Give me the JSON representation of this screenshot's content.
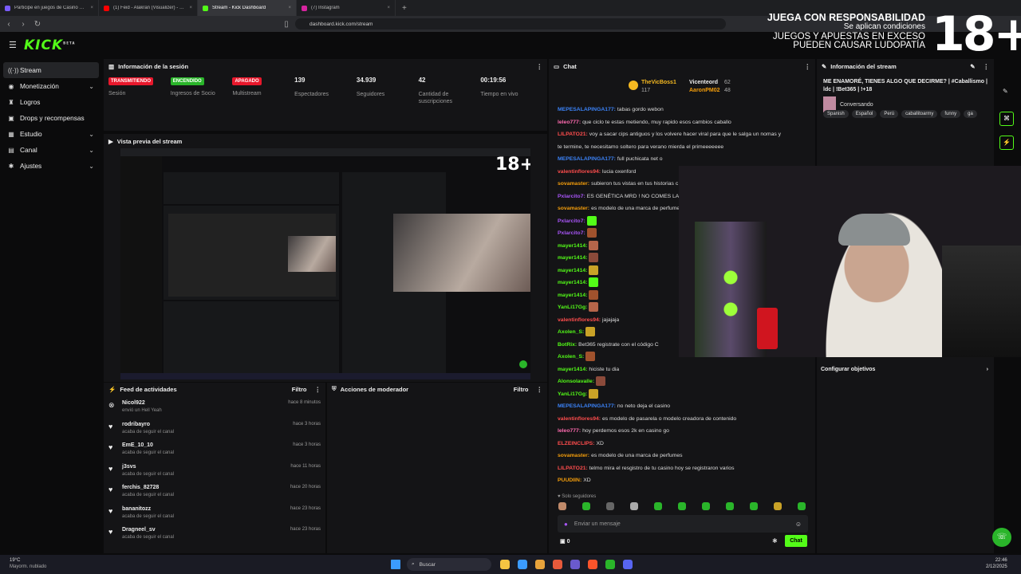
{
  "browser": {
    "tabs": [
      {
        "title": "Participe en juegos de Casino en líne",
        "color": "#7a5cff",
        "active": false
      },
      {
        "title": "(1) Feid - Alakran (Visualizer) - YouTu",
        "color": "#ff0000",
        "active": false
      },
      {
        "title": "Stream - Kick Dashboard",
        "color": "#53fc18",
        "active": true
      },
      {
        "title": "(7) Instagram",
        "color": "#d6249f",
        "active": false
      }
    ],
    "url": "dashboard.kick.com/stream"
  },
  "overlay": {
    "line1": "JUEGA CON RESPONSABILIDAD",
    "line2": "Se aplican condiciones",
    "line3": "JUEGOS Y APUESTAS EN EXCESO",
    "line4": "PUEDEN CAUSAR LUDOPATÍA",
    "age": "18+"
  },
  "sidebar": {
    "logo": "KICK",
    "logo_sup": "BETA",
    "items": [
      {
        "label": "Stream",
        "icon": "broadcast-icon",
        "glyph": "((·))",
        "chevron": false,
        "active": true
      },
      {
        "label": "Monetización",
        "icon": "money-icon",
        "glyph": "◉",
        "chevron": true,
        "active": false
      },
      {
        "label": "Logros",
        "icon": "trophy-icon",
        "glyph": "♜",
        "chevron": false,
        "active": false
      },
      {
        "label": "Drops y recompensas",
        "icon": "gift-icon",
        "glyph": "▣",
        "chevron": false,
        "active": false
      },
      {
        "label": "Estudio",
        "icon": "studio-icon",
        "glyph": "▦",
        "chevron": true,
        "active": false
      },
      {
        "label": "Canal",
        "icon": "channel-icon",
        "glyph": "▤",
        "chevron": true,
        "active": false
      },
      {
        "label": "Ajustes",
        "icon": "gear-icon",
        "glyph": "✱",
        "chevron": true,
        "active": false
      }
    ]
  },
  "session": {
    "title": "Información de la sesión",
    "stats": [
      {
        "value": "TRANSMITIENDO",
        "label": "Sesión",
        "badge": true,
        "color": "#e8182c"
      },
      {
        "value": "ENCENDIDO",
        "label": "Ingresos de Socio",
        "badge": true,
        "color": "#2ab52a"
      },
      {
        "value": "APAGADO",
        "label": "Multistream",
        "badge": true,
        "color": "#e8182c"
      },
      {
        "value": "139",
        "label": "Espectadores",
        "badge": false
      },
      {
        "value": "34.939",
        "label": "Seguidores",
        "badge": false
      },
      {
        "value": "42",
        "label": "Cantidad de suscripciones",
        "badge": false
      },
      {
        "value": "00:19:56",
        "label": "Tiempo en vivo",
        "badge": false
      }
    ]
  },
  "preview": {
    "title": "Vista previa del stream"
  },
  "feed": {
    "title": "Feed de actividades",
    "filter": "Filtro",
    "items": [
      {
        "icon": "kick-icon",
        "name": "Nicol922",
        "desc": "envió un Hell Yeah",
        "time": "hace 8 minutos"
      },
      {
        "icon": "heart-icon",
        "name": "rodribayro",
        "desc": "acaba de seguir el canal",
        "time": "hace 3 horas"
      },
      {
        "icon": "heart-icon",
        "name": "EmE_10_10",
        "desc": "acaba de seguir el canal",
        "time": "hace 3 horas"
      },
      {
        "icon": "heart-icon",
        "name": "j3svs",
        "desc": "acaba de seguir el canal",
        "time": "hace 11 horas"
      },
      {
        "icon": "heart-icon",
        "name": "ferchis_82728",
        "desc": "acaba de seguir el canal",
        "time": "hace 20 horas"
      },
      {
        "icon": "heart-icon",
        "name": "bananitozz",
        "desc": "acaba de seguir el canal",
        "time": "hace 23 horas"
      },
      {
        "icon": "heart-icon",
        "name": "Dragneel_sv",
        "desc": "acaba de seguir el canal",
        "time": "hace 23 horas"
      }
    ]
  },
  "mod": {
    "title": "Acciones de moderador",
    "filter": "Filtro"
  },
  "chat": {
    "title": "Chat",
    "top": [
      {
        "name": "TheVicBoss1",
        "count": "117"
      },
      {
        "name": "Vicenteord",
        "count": "62"
      },
      {
        "name": "AaronPM02",
        "count": "48"
      }
    ],
    "lines": [
      {
        "user": "MEPESALAPINGA177:",
        "color": "#3b82f6",
        "text": "tabas gordo webon"
      },
      {
        "user": "leleo777:",
        "color": "#ff6bb0",
        "text": "que ciclo te estas metiendo, muy rapido esos cambios caballo"
      },
      {
        "user": "LILPATO21:",
        "color": "#ff4d4d",
        "text": "voy a sacar cips antiguos y los volvere hacer viral para que le salga un nomas y"
      },
      {
        "user": "",
        "color": "#ddd",
        "text": "te termine, te necesitamo soltero para verano mierda el primeeeeeee"
      },
      {
        "user": "MEPESALAPINGA177:",
        "color": "#3b82f6",
        "text": "full puchicata net o"
      },
      {
        "user": "valentinflores94:",
        "color": "#ff4d4d",
        "text": "lucia oxenford"
      },
      {
        "user": "sovamaster:",
        "color": "#f59e0b",
        "text": "subieron tus vistas en tus historias c"
      },
      {
        "user": "Pxlarcito7:",
        "color": "#a855f7",
        "text": "ES GENÉTICA MRD ! NO COMES LA SU"
      },
      {
        "user": "sovamaster:",
        "color": "#f59e0b",
        "text": "es modelo de una marca de perfume"
      },
      {
        "user": "Pxlarcito7:",
        "color": "#a855f7",
        "text": ""
      },
      {
        "user": "Pxlarcito7:",
        "color": "#a855f7",
        "text": ""
      },
      {
        "user": "mayer1414:",
        "color": "#53fc18",
        "text": ""
      },
      {
        "user": "mayer1414:",
        "color": "#53fc18",
        "text": ""
      },
      {
        "user": "mayer1414:",
        "color": "#53fc18",
        "text": ""
      },
      {
        "user": "mayer1414:",
        "color": "#53fc18",
        "text": ""
      },
      {
        "user": "mayer1414:",
        "color": "#53fc18",
        "text": ""
      },
      {
        "user": "YanLi17Gg:",
        "color": "#53fc18",
        "text": ""
      },
      {
        "user": "valentinflores94:",
        "color": "#ff4d4d",
        "text": "jajajaja"
      },
      {
        "user": "Axolen_S:",
        "color": "#53fc18",
        "text": ""
      },
      {
        "user": "BotRix:",
        "color": "#53fc18",
        "text": "Bet365 registrate con el código C"
      },
      {
        "user": "Axolen_S:",
        "color": "#53fc18",
        "text": ""
      },
      {
        "user": "mayer1414:",
        "color": "#53fc18",
        "text": "hiciste tu dia"
      },
      {
        "user": "Alonsolavalle:",
        "color": "#53fc18",
        "text": ""
      },
      {
        "user": "YanLi17Gg:",
        "color": "#53fc18",
        "text": ""
      },
      {
        "user": "MEPESALAPINGA177:",
        "color": "#3b82f6",
        "text": "no neto deja el casino"
      },
      {
        "user": "valentinflores94:",
        "color": "#ff4d4d",
        "text": "es modelo de pasarela o modelo creadora de contenido"
      },
      {
        "user": "leleo777:",
        "color": "#ff6bb0",
        "text": "hoy perdemos esos 2k en casino go"
      },
      {
        "user": "ELZEINCLIPS:",
        "color": "#ff4d4d",
        "text": "XD"
      },
      {
        "user": "sovamaster:",
        "color": "#f59e0b",
        "text": "es modelo de una marca de perfumes"
      },
      {
        "user": "LILPATO21:",
        "color": "#ff4d4d",
        "text": "telmo mira el resgistro de tu casino hoy se registraron varios"
      },
      {
        "user": "PUUDIIN:",
        "color": "#f59e0b",
        "text": "XD"
      }
    ],
    "followers_only": "Solo seguidores",
    "placeholder": "Enviar un mensaje",
    "send": "Chat",
    "points": "0"
  },
  "stream_info": {
    "title": "Información del stream",
    "stream_title": "ME ENAMORÉ, TIENES ALGO QUE DECIRME? | #Caballismo | ldc | !Bet365 | !+18",
    "category": "Conversando",
    "tags": [
      "Spanish",
      "Español",
      "Perú",
      "caballitoarmy",
      "funny",
      "ga"
    ],
    "goals": "Configurar objetivos"
  },
  "taskbar": {
    "weather_temp": "19°C",
    "weather_desc": "Mayorm. nublado",
    "search": "Buscar",
    "time": "22:46",
    "date": "2/12/2025"
  }
}
